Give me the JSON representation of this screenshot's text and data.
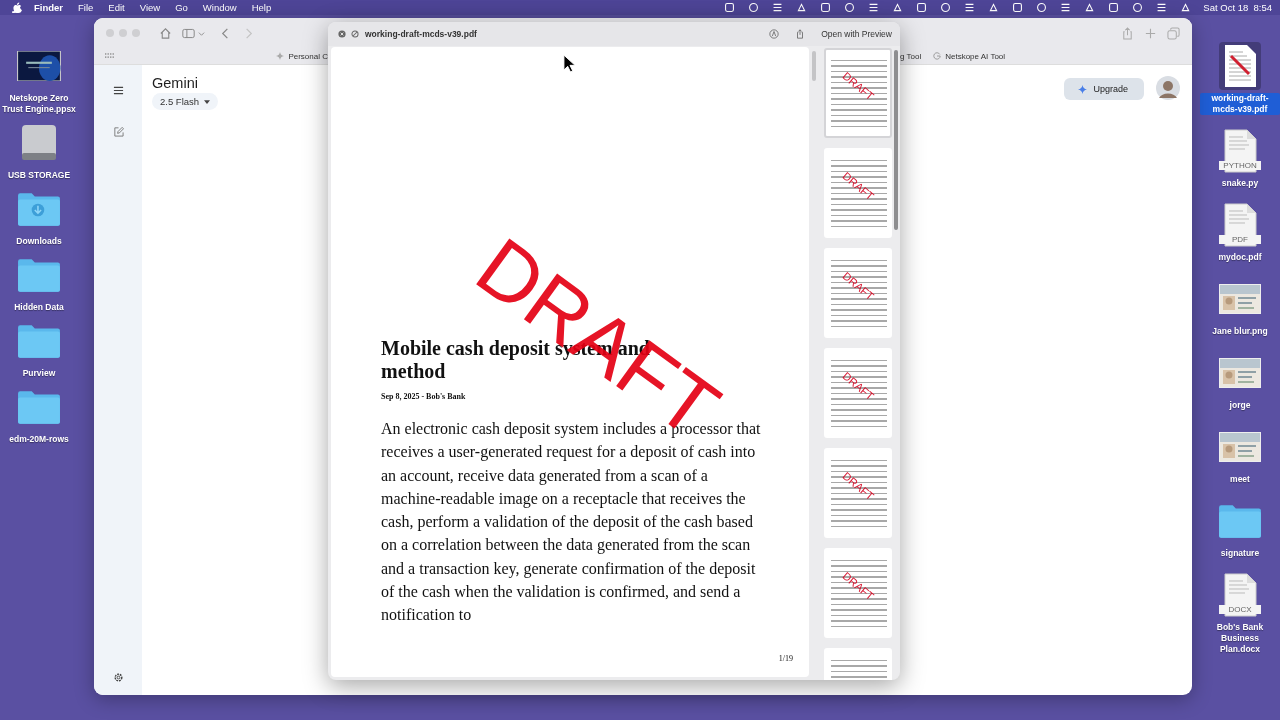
{
  "menu_bar": {
    "app": "Finder",
    "menus": [
      "File",
      "Edit",
      "View",
      "Go",
      "Window",
      "Help"
    ],
    "clock": "Sat Oct 18  8:54"
  },
  "desktop_left": [
    {
      "label": "Netskope Zero Trust Engine.ppsx",
      "kind": "slide",
      "selected": false
    },
    {
      "label": "USB STORAGE",
      "kind": "drive",
      "selected": false
    },
    {
      "label": "Downloads",
      "kind": "downloads",
      "selected": false
    },
    {
      "label": "Hidden Data",
      "kind": "folder",
      "selected": false
    },
    {
      "label": "Purview",
      "kind": "folder",
      "selected": false
    },
    {
      "label": "edm-20M-rows",
      "kind": "folder",
      "selected": false
    }
  ],
  "desktop_right": [
    {
      "label": "working-draft-mcds-v39.pdf",
      "kind": "draft",
      "selected": true
    },
    {
      "label": "snake.py",
      "kind": "doc",
      "badge": "PYTHON",
      "selected": false
    },
    {
      "label": "mydoc.pdf",
      "kind": "doc",
      "badge": "PDF",
      "selected": false
    },
    {
      "label": "Jane blur.png",
      "kind": "picture",
      "selected": false
    },
    {
      "label": "jorge",
      "kind": "picture",
      "selected": false
    },
    {
      "label": "meet",
      "kind": "picture",
      "selected": false
    },
    {
      "label": "signature",
      "kind": "folder",
      "selected": false
    },
    {
      "label": "Bob's Bank Business Plan.docx",
      "kind": "doc",
      "badge": "DOCX",
      "selected": false
    }
  ],
  "browser": {
    "bookmarks_left": [
      {
        "label": "Personal C",
        "kind": "sparkle"
      }
    ],
    "bookmarks_right": [
      {
        "label": "g Tool",
        "kind": "plain"
      },
      {
        "label": "Netskope AI Tool",
        "kind": "google"
      }
    ],
    "app": {
      "title": "Gemini",
      "model": "2.5 Flash",
      "upgrade": "Upgrade"
    }
  },
  "quick_look": {
    "filename": "working-draft-mcds-v39.pdf",
    "open_button": "Open with Preview",
    "page": {
      "watermark": "DRAFT",
      "title": "Mobile cash deposit system and method",
      "meta": "Sep 8, 2025 - Bob's Bank",
      "body": "An electronic cash deposit system includes a processor that receives a user-generated request for a deposit of cash into an account, receive data generated from a scan of a machine-readable image on a receptacle that receives the cash, perform a validation of the deposit of the cash based on a correlation between the data generated from the scan and a transaction key, generate confirmation of the deposit of the cash when the validation is confirmed, and send a notification to",
      "page_number": "1/19"
    },
    "thumbnails": [
      {
        "watermark": "DRAFT",
        "selected": true
      },
      {
        "watermark": "DRAFT",
        "selected": false
      },
      {
        "watermark": "DRAFT",
        "selected": false
      },
      {
        "watermark": "DRAFT",
        "selected": false
      },
      {
        "watermark": "DRAFT",
        "selected": false
      },
      {
        "watermark": "DRAFT",
        "selected": false
      },
      {
        "selected": false
      }
    ]
  }
}
